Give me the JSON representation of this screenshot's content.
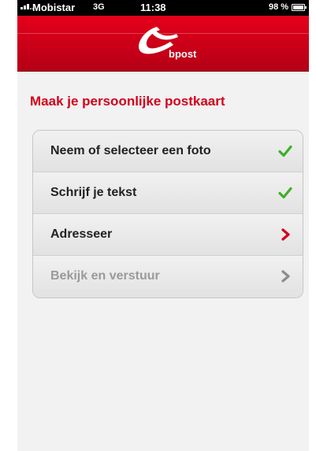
{
  "status_bar": {
    "carrier": "Mobistar",
    "network": "3G",
    "time": "11:38",
    "battery_percent_text": "98 %",
    "battery_level": 0.98
  },
  "nav": {
    "brand_text": "bpost",
    "logo_icon": "bpost-horn-logo-icon"
  },
  "main": {
    "title": "Maak je persoonlijke postkaart",
    "menu": [
      {
        "label": "Neem of selecteer een foto",
        "icon": "checkmark-icon",
        "state": "done"
      },
      {
        "label": "Schrijf je tekst",
        "icon": "checkmark-icon",
        "state": "done"
      },
      {
        "label": "Adresseer",
        "icon": "chevron-right-icon",
        "state": "active"
      },
      {
        "label": "Bekijk en verstuur",
        "icon": "chevron-right-icon",
        "state": "disabled"
      }
    ]
  },
  "colors": {
    "brand_red": "#d2001c",
    "check_green": "#3fae2a",
    "chevron_red": "#d2001c",
    "chevron_gray": "#8c8c8c"
  }
}
